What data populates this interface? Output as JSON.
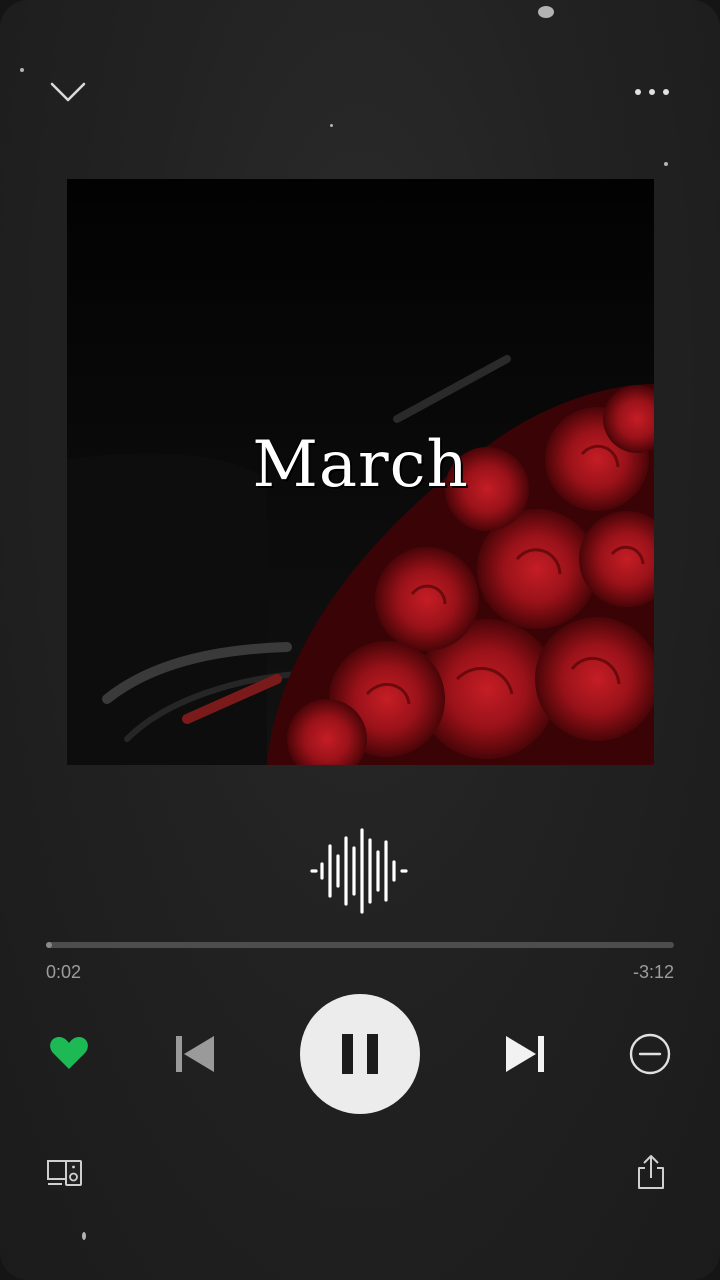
{
  "header": {
    "collapse_icon": "chevron-down-icon",
    "more_icon": "more-horizontal-icon"
  },
  "cover": {
    "title": "March",
    "rose_color": "#a3141c"
  },
  "visualizer_icon": "sound-wave-icon",
  "playback": {
    "elapsed": "0:02",
    "remaining": "-3:12",
    "progress_fraction": 0.01
  },
  "controls": {
    "like_icon": "heart-filled-icon",
    "like_color": "#1db954",
    "prev_icon": "skip-previous-icon",
    "pause_icon": "pause-icon",
    "next_icon": "skip-next-icon",
    "hide_icon": "minus-circle-icon",
    "device_icon": "connect-device-icon",
    "share_icon": "share-icon"
  },
  "colors": {
    "background": "#222222",
    "track": "#4d4d4d",
    "text_muted": "#9d9d9d"
  }
}
